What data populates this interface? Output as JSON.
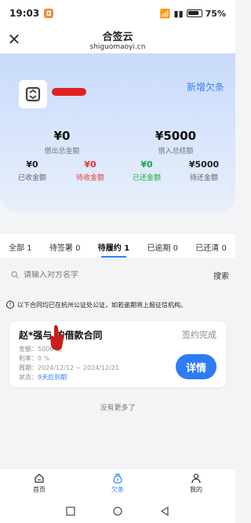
{
  "status_bar": {
    "time": "19:03",
    "battery": "75%"
  },
  "header": {
    "title": "合签云",
    "subtitle": "shiguomaoyi.cn"
  },
  "hero": {
    "add_debt_label": "新增欠条",
    "lent_total": {
      "value": "¥0",
      "label": "借出总金额"
    },
    "borrowed_total": {
      "value": "¥5000",
      "label": "借入总结额"
    },
    "received": {
      "value": "¥0",
      "label": "已收金额"
    },
    "to_receive": {
      "value": "¥0",
      "label": "待收金额"
    },
    "repaid": {
      "value": "¥0",
      "label": "已还金额"
    },
    "to_repay": {
      "value": "¥5000",
      "label": "待还金额"
    }
  },
  "tabs": [
    {
      "label": "全部 1"
    },
    {
      "label": "待签署 0"
    },
    {
      "label": "待履约 1"
    },
    {
      "label": "已逾期 0"
    },
    {
      "label": "已还清 0"
    }
  ],
  "search": {
    "placeholder": "请输入对方名字",
    "button": "搜索"
  },
  "notice": "以下合同均已在杭州公证处公证，如若逾期将上报征信机构。",
  "contract": {
    "title": "赵*强与 的借款合同",
    "status": "签约完成",
    "amount_label": "金额：",
    "amount_value": "5000 元",
    "rate_label": "利率：",
    "rate_value": "0 %",
    "period_label": "周期：",
    "period_value": "2024/12/12 ~ 2024/12/21",
    "state_label": "状态：",
    "state_value": "9天后到期",
    "detail_button": "详情"
  },
  "no_more": "没有更多了",
  "bottom_nav": [
    {
      "label": "首页"
    },
    {
      "label": "欠条"
    },
    {
      "label": "我的"
    }
  ],
  "colors": {
    "accent": "#2f7fff",
    "danger": "#e03c3c",
    "success": "#16a84a"
  }
}
